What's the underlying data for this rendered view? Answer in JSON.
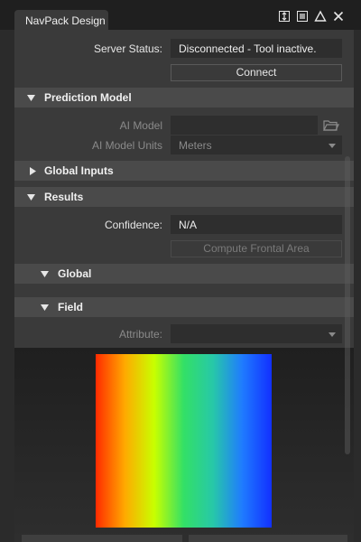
{
  "window": {
    "tab_title": "NavPack Design",
    "icons": [
      "pin-icon",
      "menu-icon",
      "float-icon",
      "close-icon"
    ]
  },
  "server": {
    "status_label": "Server Status:",
    "status_value": "Disconnected - Tool inactive.",
    "connect_label": "Connect"
  },
  "prediction_model": {
    "title": "Prediction Model",
    "ai_model_label": "AI Model",
    "ai_model_value": "",
    "units_label": "AI Model Units",
    "units_value": "Meters"
  },
  "global_inputs": {
    "title": "Global Inputs"
  },
  "results": {
    "title": "Results",
    "confidence_label": "Confidence:",
    "confidence_value": "N/A",
    "compute_label": "Compute Frontal Area",
    "global_title": "Global",
    "field_title": "Field",
    "attribute_label": "Attribute:",
    "attribute_value": ""
  },
  "colormap": {
    "colors": [
      "#ff2a00",
      "#ffaa00",
      "#c8ff00",
      "#33e066",
      "#27c8a8",
      "#1f7bff",
      "#1230ff"
    ]
  }
}
